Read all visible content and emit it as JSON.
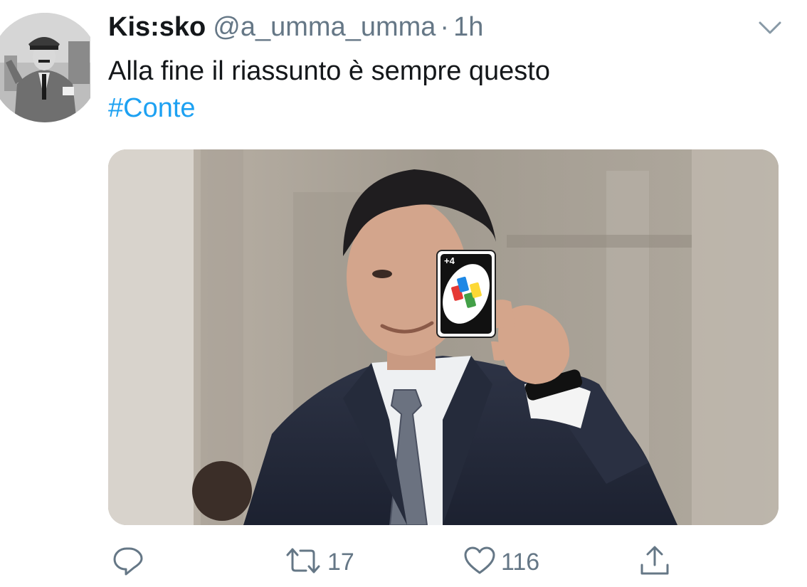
{
  "tweet": {
    "display_name": "Kis:sko",
    "handle": "@a_umma_umma",
    "separator": "·",
    "time": "1h",
    "text": "Alla fine il riassunto è sempre questo",
    "hashtag": "#Conte",
    "media": {
      "card_label": "+4"
    }
  },
  "actions": {
    "reply": {
      "icon": "reply-icon",
      "count": ""
    },
    "retweet": {
      "icon": "retweet-icon",
      "count": "17"
    },
    "like": {
      "icon": "heart-icon",
      "count": "116"
    },
    "share": {
      "icon": "share-icon",
      "count": ""
    }
  },
  "colors": {
    "text": "#14171a",
    "secondary": "#657786",
    "accent": "#1da1f2",
    "background": "#ffffff"
  }
}
